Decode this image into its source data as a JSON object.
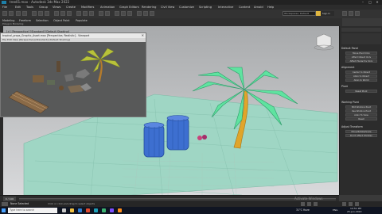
{
  "window": {
    "title": "tree01.max - Autodesk 3ds Max 2022",
    "controls": [
      "–",
      "□",
      "✕"
    ]
  },
  "menubar": {
    "items": [
      "File",
      "Edit",
      "Tools",
      "Group",
      "Views",
      "Create",
      "Modifiers",
      "Animation",
      "Graph Editors",
      "Rendering",
      "Civil View",
      "Customize",
      "Scripting",
      "Interactive",
      "Content",
      "Arnold",
      "Help"
    ]
  },
  "toolbar": {
    "workspace_value": "Workspaces: Default",
    "signin_label": "Sign In"
  },
  "ribbon": {
    "tabs": [
      "Modeling",
      "Freeform",
      "Selection",
      "Object Paint",
      "Populate"
    ],
    "sub_label": "Polygon Modeling"
  },
  "viewer": {
    "title": "tropical_props_Graphic_Asset.max [Perspective, Realistic] - Viewport",
    "bar": "File  Edit  View  [Perspective]  [Standard]  [Default Shading]"
  },
  "viewport": {
    "label": "[+] [Perspective] [Standard] [Default Shading]",
    "grid_color": "#9fd6c4",
    "barrel_color": "#3d6fd0",
    "trunk_color": "#e0a52a",
    "leaf_color": "#5fe3a0"
  },
  "cmdpanel": {
    "rollouts": [
      {
        "header": "Default Panel",
        "buttons": [
          "Move Pivot Only",
          "Affect Object Only",
          "Affect Hierarchy Only"
        ]
      },
      {
        "header": "Alignment",
        "buttons": [
          "Center to Object",
          "Align to Object",
          "Align to World"
        ]
      },
      {
        "header": "Pivot",
        "buttons": [
          "Reset Pivot"
        ]
      },
      {
        "header": "Working Pivot",
        "buttons": [
          "Edit Working Pivot",
          "Use Working Pivot",
          "Align To View",
          "Reset"
        ]
      },
      {
        "header": "Adjust Transform",
        "buttons": [
          "Move/Rotate/Scale",
          "Don't Affect Children"
        ]
      }
    ]
  },
  "timeline": {
    "frame": "0 / 100"
  },
  "status": {
    "selection": "None Selected",
    "hint": "Click or click-and-drag to select objects",
    "activate": "Activate Windows"
  },
  "taskbar": {
    "search_placeholder": "Type here to search",
    "clock": "10:51 PM",
    "date": "25-Jun-2022",
    "weather": "31°C  Haze",
    "lang": "ENG"
  }
}
